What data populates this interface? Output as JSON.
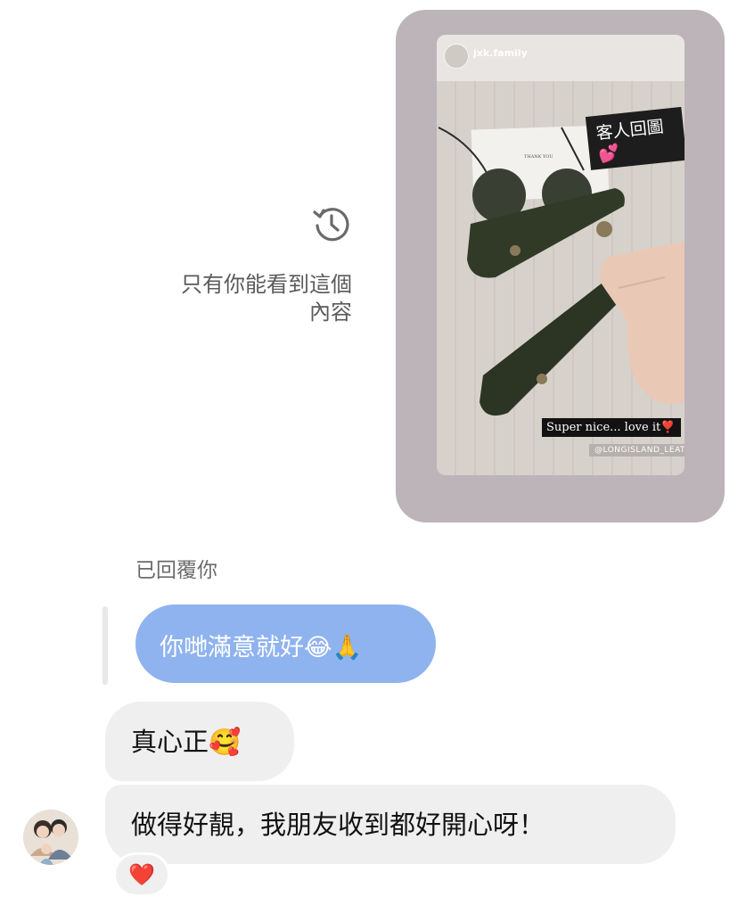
{
  "history_notice": {
    "icon": "history-clock-icon",
    "text_line1": "只有你能看到這個",
    "text_line2": "內容"
  },
  "story": {
    "account": "jxk.family",
    "sticker": "客人回圖💕",
    "caption": "Super nice... love it❣️",
    "handle": "@LONGISLAND_LEATHER"
  },
  "reply_label": "已回覆你",
  "replied_message": "你哋滿意就好😂🙏",
  "messages": [
    {
      "text": "真心正🥰"
    },
    {
      "text": "做得好靚，我朋友收到都好開心呀！"
    }
  ],
  "reaction": "❤️",
  "colors": {
    "replied_bubble": "#8fb3ef",
    "bubble": "#efefef",
    "story_card": "#bcb4b8"
  }
}
